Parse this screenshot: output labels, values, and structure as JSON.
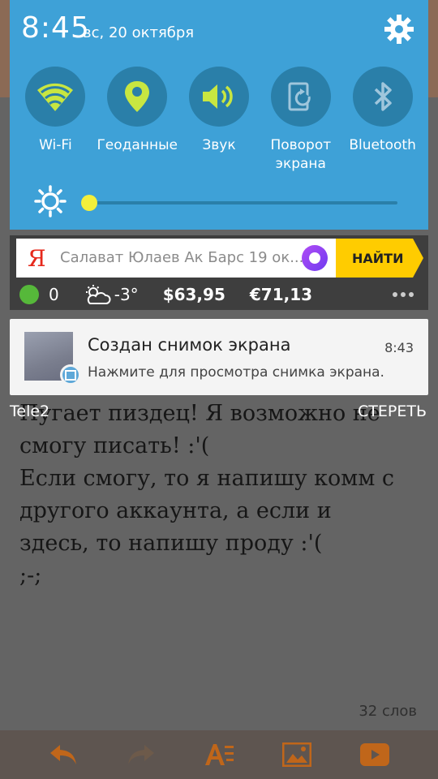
{
  "background_app": {
    "text_lines": [
      "Пугает пиздец! Я возможно не",
      "смогу писать! :'(",
      "Если смогу, то я напишу комм с",
      "другого аккаунта, а если и",
      "здесь, то напишу проду :'(",
      ";-;"
    ],
    "word_count": "32 слов",
    "toolbar_icons": [
      "undo-icon",
      "redo-icon",
      "text-format-icon",
      "image-icon",
      "video-icon"
    ]
  },
  "status": {
    "time": "8:45",
    "date": "вс, 20 октября"
  },
  "quick_settings": [
    {
      "label": "Wi-Fi",
      "icon": "wifi-icon"
    },
    {
      "label": "Геоданные",
      "icon": "location-icon"
    },
    {
      "label": "Звук",
      "icon": "sound-icon"
    },
    {
      "label": "Поворот\nэкрана",
      "icon": "rotate-icon"
    },
    {
      "label": "Bluetooth",
      "icon": "bluetooth-icon"
    }
  ],
  "brightness": {
    "level": 0.0
  },
  "yandex_widget": {
    "logo": "Я",
    "query": "Салават Юлаев Ак Барс 19 ок...",
    "button": "НАЙТИ",
    "traffic": "0",
    "weather": "-3°",
    "usd": "$63,95",
    "eur": "€71,13"
  },
  "notification": {
    "title": "Создан снимок экрана",
    "time": "8:43",
    "text": "Нажмите для просмотра снимка экрана."
  },
  "footer": {
    "carrier": "Tele2",
    "clear": "СТЕРЕТЬ"
  },
  "colors": {
    "panel": "#3ea1d7",
    "qs_circle": "#2a7fa9",
    "active_icon": "#c8e641",
    "slider_thumb": "#f4ef3b",
    "yandex_button": "#ffcc00"
  }
}
